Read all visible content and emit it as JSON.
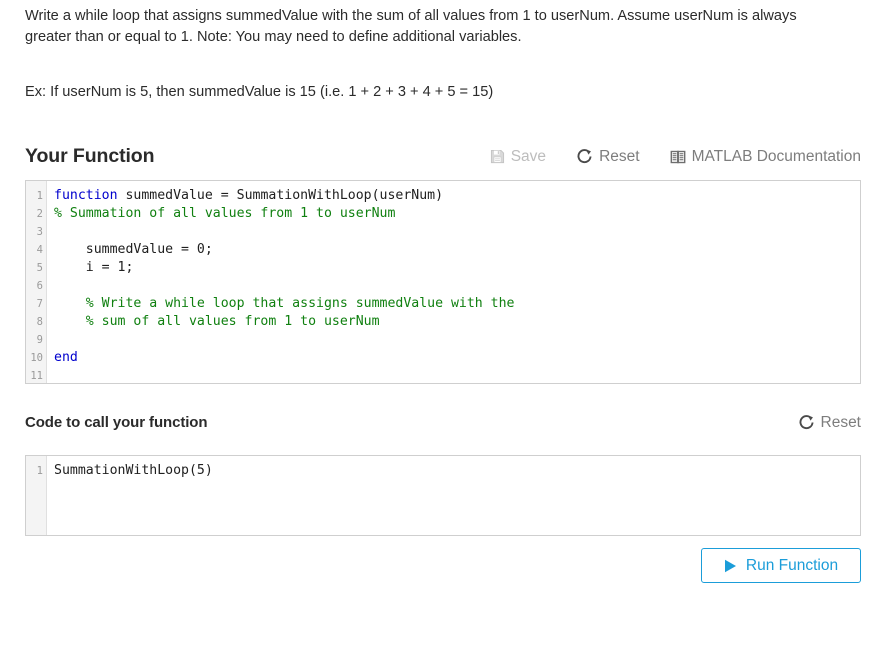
{
  "prompt": {
    "paragraph": "Write a while loop that assigns summedValue with the sum of all values from 1 to userNum. Assume userNum is always greater than or equal to 1. Note: You may need to define additional variables.",
    "example": "Ex: If userNum is 5, then summedValue is 15 (i.e. 1 + 2 + 3 + 4 + 5 = 15)"
  },
  "function_section": {
    "title": "Your Function",
    "toolbar": {
      "save_label": "Save",
      "reset_label": "Reset",
      "docs_label": "MATLAB Documentation"
    },
    "line_numbers": [
      "1",
      "2",
      "3",
      "4",
      "5",
      "6",
      "7",
      "8",
      "9",
      "10",
      "11"
    ],
    "code_lines": [
      [
        {
          "t": "function",
          "c": "kw"
        },
        {
          "t": " summedValue = SummationWithLoop(userNum)",
          "c": ""
        }
      ],
      [
        {
          "t": "% Summation of all values from 1 to userNum",
          "c": "cm"
        }
      ],
      [],
      [
        {
          "t": "    summedValue = 0;",
          "c": ""
        }
      ],
      [
        {
          "t": "    i = 1;",
          "c": ""
        }
      ],
      [],
      [
        {
          "t": "    % Write a while loop that assigns summedValue with the",
          "c": "cm"
        }
      ],
      [
        {
          "t": "    % sum of all values from 1 to userNum",
          "c": "cm"
        }
      ],
      [],
      [
        {
          "t": "end",
          "c": "kw"
        }
      ],
      []
    ]
  },
  "call_section": {
    "title": "Code to call your function",
    "toolbar": {
      "reset_label": "Reset"
    },
    "line_numbers": [
      "1"
    ],
    "code_lines": [
      [
        {
          "t": "SummationWithLoop(5)",
          "c": ""
        }
      ]
    ]
  },
  "run_button": {
    "label": "Run Function"
  },
  "colors": {
    "accent": "#1b9dd9",
    "keyword": "#0000cd",
    "comment": "#108010",
    "text": "#2b2b2b",
    "muted": "#7d7d7d",
    "disabled": "#bdbdbd",
    "border": "#cfcfcf",
    "gutter_bg": "#f4f4f4"
  }
}
